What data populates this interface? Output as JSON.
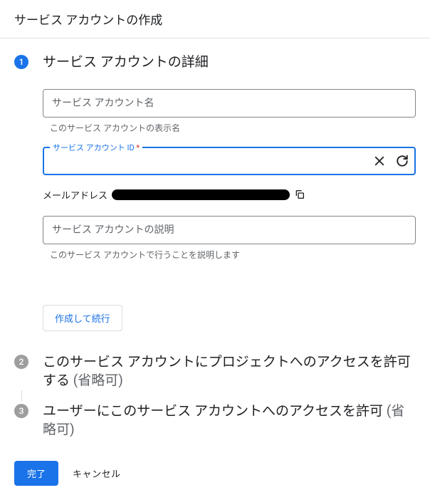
{
  "header": {
    "title": "サービス アカウントの作成"
  },
  "steps": {
    "step1": {
      "number": "1",
      "title": "サービス アカウントの詳細"
    },
    "step2": {
      "number": "2",
      "title_main": "このサービス アカウントにプロジェクトへのアクセスを許可する ",
      "title_optional": "(省略可)"
    },
    "step3": {
      "number": "3",
      "title_main": "ユーザーにこのサービス アカウントへのアクセスを許可 ",
      "title_optional": "(省略可)"
    }
  },
  "form": {
    "name_placeholder": "サービス アカウント名",
    "name_helper": "このサービス アカウントの表示名",
    "id_label": "サービス アカウント ID ",
    "id_required_mark": "*",
    "id_value": "",
    "email_label": "メールアドレス",
    "description_placeholder": "サービス アカウントの説明",
    "description_helper": "このサービス アカウントで行うことを説明します",
    "create_continue_label": "作成して続行"
  },
  "actions": {
    "done_label": "完了",
    "cancel_label": "キャンセル"
  }
}
